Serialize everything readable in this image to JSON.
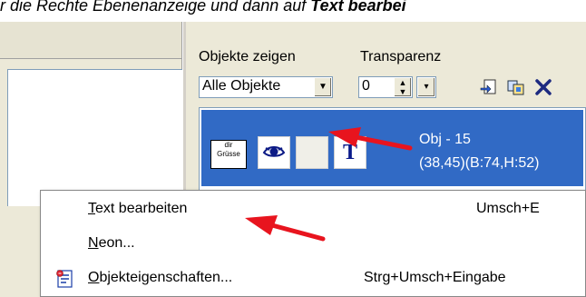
{
  "caption": {
    "prefix": "r die Rechte Ebenenanzeige und dann auf ",
    "bold": "Text bearbei"
  },
  "panel": {
    "objects_label": "Objekte zeigen",
    "objects_value": "Alle Objekte",
    "transparency_label": "Transparenz",
    "transparency_value": "0",
    "toolbar_icons": [
      "import-icon",
      "copy-objects-icon",
      "delete-icon"
    ]
  },
  "layer": {
    "thumb_text_line1": "dir",
    "thumb_text_line2": "Grüsse",
    "name": "Obj - 15",
    "geometry": "(38,45)(B:74,H:52)",
    "visibility_icon": "eye-icon",
    "type_icon": "text-T-icon"
  },
  "context_menu": {
    "items": [
      {
        "first": "T",
        "rest": "ext bearbeiten",
        "shortcut": "Umsch+E"
      },
      {
        "first": "N",
        "rest": "eon...",
        "shortcut": ""
      },
      {
        "first": "O",
        "rest": "bjekteigenschaften...",
        "shortcut": "Strg+Umsch+Eingabe",
        "icon": "properties-icon"
      }
    ]
  },
  "colors": {
    "selection": "#316ac5",
    "annotation_arrow": "#e8141e",
    "window_bg": "#ece9d8"
  }
}
